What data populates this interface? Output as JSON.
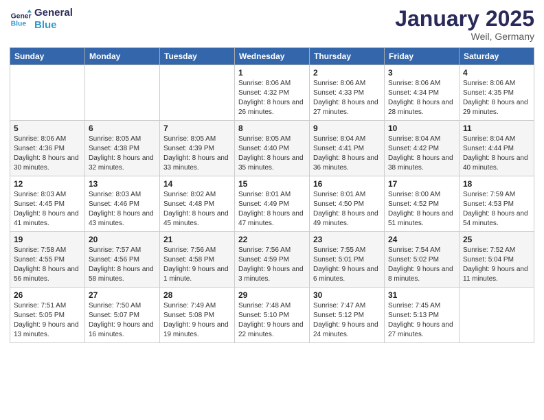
{
  "header": {
    "logo_line1": "General",
    "logo_line2": "Blue",
    "month": "January 2025",
    "location": "Weil, Germany"
  },
  "weekdays": [
    "Sunday",
    "Monday",
    "Tuesday",
    "Wednesday",
    "Thursday",
    "Friday",
    "Saturday"
  ],
  "weeks": [
    [
      {
        "day": "",
        "info": ""
      },
      {
        "day": "",
        "info": ""
      },
      {
        "day": "",
        "info": ""
      },
      {
        "day": "1",
        "info": "Sunrise: 8:06 AM\nSunset: 4:32 PM\nDaylight: 8 hours and 26 minutes."
      },
      {
        "day": "2",
        "info": "Sunrise: 8:06 AM\nSunset: 4:33 PM\nDaylight: 8 hours and 27 minutes."
      },
      {
        "day": "3",
        "info": "Sunrise: 8:06 AM\nSunset: 4:34 PM\nDaylight: 8 hours and 28 minutes."
      },
      {
        "day": "4",
        "info": "Sunrise: 8:06 AM\nSunset: 4:35 PM\nDaylight: 8 hours and 29 minutes."
      }
    ],
    [
      {
        "day": "5",
        "info": "Sunrise: 8:06 AM\nSunset: 4:36 PM\nDaylight: 8 hours and 30 minutes."
      },
      {
        "day": "6",
        "info": "Sunrise: 8:05 AM\nSunset: 4:38 PM\nDaylight: 8 hours and 32 minutes."
      },
      {
        "day": "7",
        "info": "Sunrise: 8:05 AM\nSunset: 4:39 PM\nDaylight: 8 hours and 33 minutes."
      },
      {
        "day": "8",
        "info": "Sunrise: 8:05 AM\nSunset: 4:40 PM\nDaylight: 8 hours and 35 minutes."
      },
      {
        "day": "9",
        "info": "Sunrise: 8:04 AM\nSunset: 4:41 PM\nDaylight: 8 hours and 36 minutes."
      },
      {
        "day": "10",
        "info": "Sunrise: 8:04 AM\nSunset: 4:42 PM\nDaylight: 8 hours and 38 minutes."
      },
      {
        "day": "11",
        "info": "Sunrise: 8:04 AM\nSunset: 4:44 PM\nDaylight: 8 hours and 40 minutes."
      }
    ],
    [
      {
        "day": "12",
        "info": "Sunrise: 8:03 AM\nSunset: 4:45 PM\nDaylight: 8 hours and 41 minutes."
      },
      {
        "day": "13",
        "info": "Sunrise: 8:03 AM\nSunset: 4:46 PM\nDaylight: 8 hours and 43 minutes."
      },
      {
        "day": "14",
        "info": "Sunrise: 8:02 AM\nSunset: 4:48 PM\nDaylight: 8 hours and 45 minutes."
      },
      {
        "day": "15",
        "info": "Sunrise: 8:01 AM\nSunset: 4:49 PM\nDaylight: 8 hours and 47 minutes."
      },
      {
        "day": "16",
        "info": "Sunrise: 8:01 AM\nSunset: 4:50 PM\nDaylight: 8 hours and 49 minutes."
      },
      {
        "day": "17",
        "info": "Sunrise: 8:00 AM\nSunset: 4:52 PM\nDaylight: 8 hours and 51 minutes."
      },
      {
        "day": "18",
        "info": "Sunrise: 7:59 AM\nSunset: 4:53 PM\nDaylight: 8 hours and 54 minutes."
      }
    ],
    [
      {
        "day": "19",
        "info": "Sunrise: 7:58 AM\nSunset: 4:55 PM\nDaylight: 8 hours and 56 minutes."
      },
      {
        "day": "20",
        "info": "Sunrise: 7:57 AM\nSunset: 4:56 PM\nDaylight: 8 hours and 58 minutes."
      },
      {
        "day": "21",
        "info": "Sunrise: 7:56 AM\nSunset: 4:58 PM\nDaylight: 9 hours and 1 minute."
      },
      {
        "day": "22",
        "info": "Sunrise: 7:56 AM\nSunset: 4:59 PM\nDaylight: 9 hours and 3 minutes."
      },
      {
        "day": "23",
        "info": "Sunrise: 7:55 AM\nSunset: 5:01 PM\nDaylight: 9 hours and 6 minutes."
      },
      {
        "day": "24",
        "info": "Sunrise: 7:54 AM\nSunset: 5:02 PM\nDaylight: 9 hours and 8 minutes."
      },
      {
        "day": "25",
        "info": "Sunrise: 7:52 AM\nSunset: 5:04 PM\nDaylight: 9 hours and 11 minutes."
      }
    ],
    [
      {
        "day": "26",
        "info": "Sunrise: 7:51 AM\nSunset: 5:05 PM\nDaylight: 9 hours and 13 minutes."
      },
      {
        "day": "27",
        "info": "Sunrise: 7:50 AM\nSunset: 5:07 PM\nDaylight: 9 hours and 16 minutes."
      },
      {
        "day": "28",
        "info": "Sunrise: 7:49 AM\nSunset: 5:08 PM\nDaylight: 9 hours and 19 minutes."
      },
      {
        "day": "29",
        "info": "Sunrise: 7:48 AM\nSunset: 5:10 PM\nDaylight: 9 hours and 22 minutes."
      },
      {
        "day": "30",
        "info": "Sunrise: 7:47 AM\nSunset: 5:12 PM\nDaylight: 9 hours and 24 minutes."
      },
      {
        "day": "31",
        "info": "Sunrise: 7:45 AM\nSunset: 5:13 PM\nDaylight: 9 hours and 27 minutes."
      },
      {
        "day": "",
        "info": ""
      }
    ]
  ]
}
